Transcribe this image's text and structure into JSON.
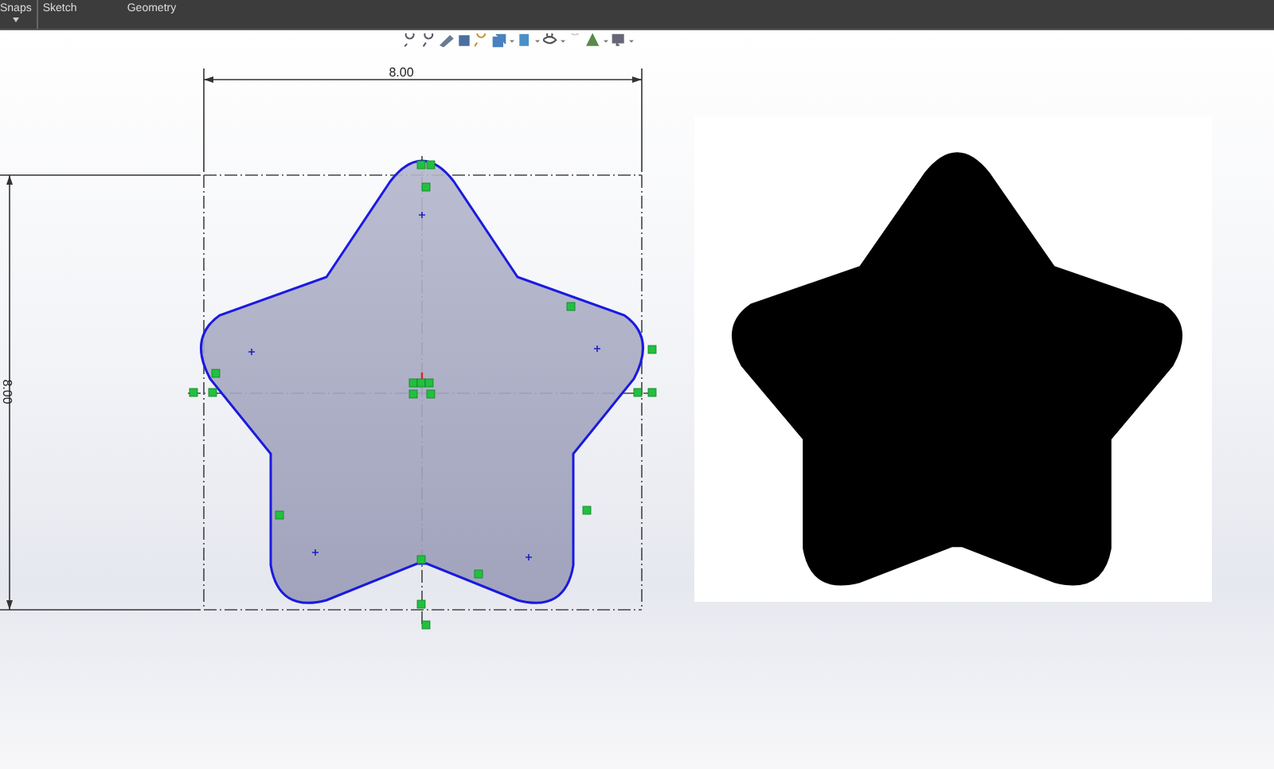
{
  "menubar": {
    "items": [
      {
        "label": "Snaps",
        "dropdown": true
      },
      {
        "label": "Sketch",
        "dropdown": false
      },
      {
        "label": "Geometry",
        "dropdown": false
      }
    ]
  },
  "sketch": {
    "width_dimension": "8.00",
    "height_dimension": "8.00"
  }
}
